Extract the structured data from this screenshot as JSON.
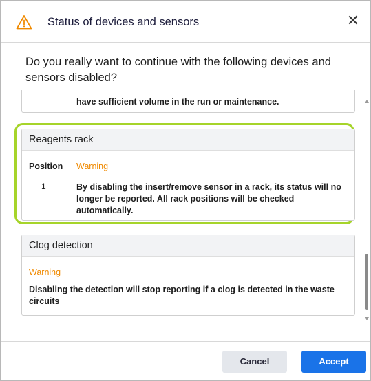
{
  "dialog": {
    "title": "Status of devices and sensors",
    "close_symbol": "✕",
    "question": "Do you really want to continue with the following devices and sensors disabled?"
  },
  "cards": {
    "partial": {
      "text": "have sufficient volume in the run or maintenance."
    },
    "reagents_rack": {
      "title": "Reagents rack",
      "position_label": "Position",
      "warning_label": "Warning",
      "position_value": "1",
      "description": "By disabling the insert/remove sensor in a rack, its status will no longer be reported. All rack positions will be checked automatically."
    },
    "clog_detection": {
      "title": "Clog detection",
      "warning_label": "Warning",
      "description": "Disabling the detection will stop reporting if a clog is detected in the waste circuits"
    }
  },
  "buttons": {
    "cancel": "Cancel",
    "accept": "Accept"
  },
  "colors": {
    "warning_text": "#f08a00",
    "warning_icon": "#f08a00",
    "highlight_border": "#a6d42a",
    "accept_button": "#1a73e8",
    "cancel_button": "#e4e7ec"
  },
  "icons": {
    "header_icon": "warning-triangle-icon",
    "close_icon": "close-icon"
  }
}
